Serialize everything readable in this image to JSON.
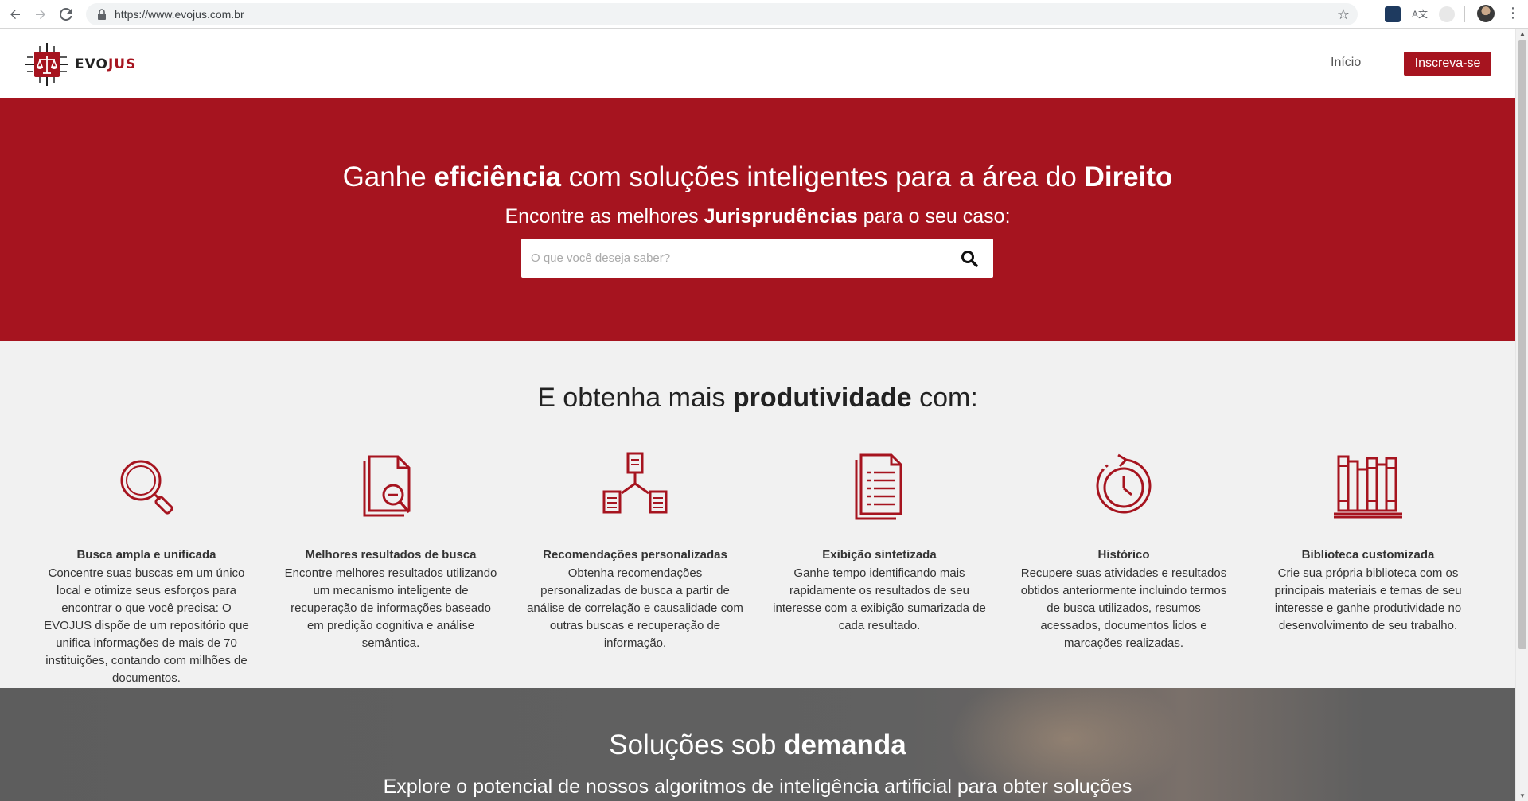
{
  "browser": {
    "url": "https://www.evojus.com.br",
    "back_icon": "arrow-left",
    "forward_icon": "arrow-right",
    "reload_icon": "reload",
    "bookmark_icon": "star"
  },
  "header": {
    "logo_text_a": "EVO",
    "logo_text_b": "JUS",
    "nav_home": "Início",
    "signup_label": "Inscreva-se"
  },
  "hero": {
    "headline_1": "Ganhe ",
    "headline_2": "eficiência",
    "headline_3": " com soluções inteligentes para a área do ",
    "headline_4": "Direito",
    "subhead_1": "Encontre as melhores ",
    "subhead_2": "Jurisprudências",
    "subhead_3": " para o seu caso:",
    "search_placeholder": "O que você deseja saber?"
  },
  "features": {
    "heading_1": "E obtenha mais ",
    "heading_2": "produtividade",
    "heading_3": " com:",
    "items": [
      {
        "icon": "magnifier-icon",
        "title": "Busca ampla e unificada",
        "desc": "Concentre suas buscas em um único local e otimize seus esforços para encontrar o que você precisa: O EVOJUS dispõe de um repositório que unifica informações de mais de 70 instituições, contando com milhões de documentos."
      },
      {
        "icon": "document-search-icon",
        "title": "Melhores resultados de busca",
        "desc": "Encontre melhores resultados utilizando um mecanismo inteligente de recuperação de informações baseado em predição cognitiva e análise semântica."
      },
      {
        "icon": "document-network-icon",
        "title": "Recomendações personalizadas",
        "desc": "Obtenha recomendações personalizadas de busca a partir de análise de correlação e causalidade com outras buscas e recuperação de informação."
      },
      {
        "icon": "document-list-icon",
        "title": "Exibição sintetizada",
        "desc": "Ganhe tempo identificando mais rapidamente os resultados de seu interesse com a exibição sumarizada de cada resultado."
      },
      {
        "icon": "history-clock-icon",
        "title": "Histórico",
        "desc": "Recupere suas atividades e resultados obtidos anteriormente incluindo termos de busca utilizados, resumos acessados, documentos lidos e marcações realizadas."
      },
      {
        "icon": "library-books-icon",
        "title": "Biblioteca customizada",
        "desc": "Crie sua própria biblioteca com os principais materiais e temas de seu interesse e ganhe produtividade no desenvolvimento de seu trabalho."
      }
    ]
  },
  "solutions": {
    "heading_1": "Soluções sob ",
    "heading_2": "demanda",
    "subtext": "Explore o potencial de nossos algoritmos de inteligência artificial para obter soluções"
  },
  "colors": {
    "brand": "#a6141f",
    "features_bg": "#f1f1f1"
  }
}
